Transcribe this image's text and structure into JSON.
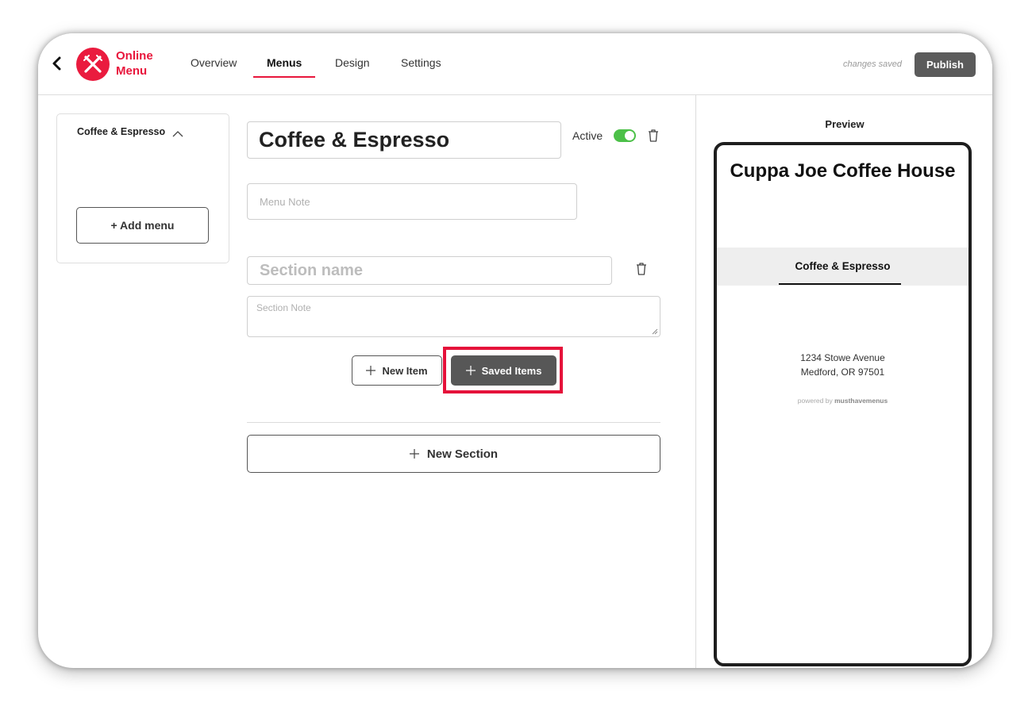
{
  "header": {
    "app_name": "Online Menu",
    "tabs": [
      {
        "label": "Overview",
        "active": false
      },
      {
        "label": "Menus",
        "active": true
      },
      {
        "label": "Design",
        "active": false
      },
      {
        "label": "Settings",
        "active": false
      }
    ],
    "status": "changes saved",
    "publish_label": "Publish",
    "accent_color": "#e8163c"
  },
  "sidebar": {
    "menus": [
      {
        "label": "Coffee & Espresso",
        "expanded": true
      }
    ],
    "add_menu_label": "+ Add menu"
  },
  "editor": {
    "menu_name": "Coffee & Espresso",
    "active_label": "Active",
    "active": true,
    "menu_note_placeholder": "Menu Note",
    "section_name_placeholder": "Section name",
    "section_note_placeholder": "Section Note",
    "new_item_label": "New Item",
    "saved_items_label": "Saved Items",
    "new_section_label": "New Section",
    "icons": [
      "back-icon",
      "fork-knife-icon",
      "trash-icon",
      "plus-icon",
      "chevron-up-icon"
    ]
  },
  "preview": {
    "title": "Preview",
    "restaurant_name": "Cuppa Joe Coffee House",
    "menu_tab": "Coffee & Espresso",
    "address_line1": "1234 Stowe Avenue",
    "address_line2": "Medford, OR 97501",
    "powered_prefix": "powered by",
    "powered_brand": "musthavemenus"
  }
}
